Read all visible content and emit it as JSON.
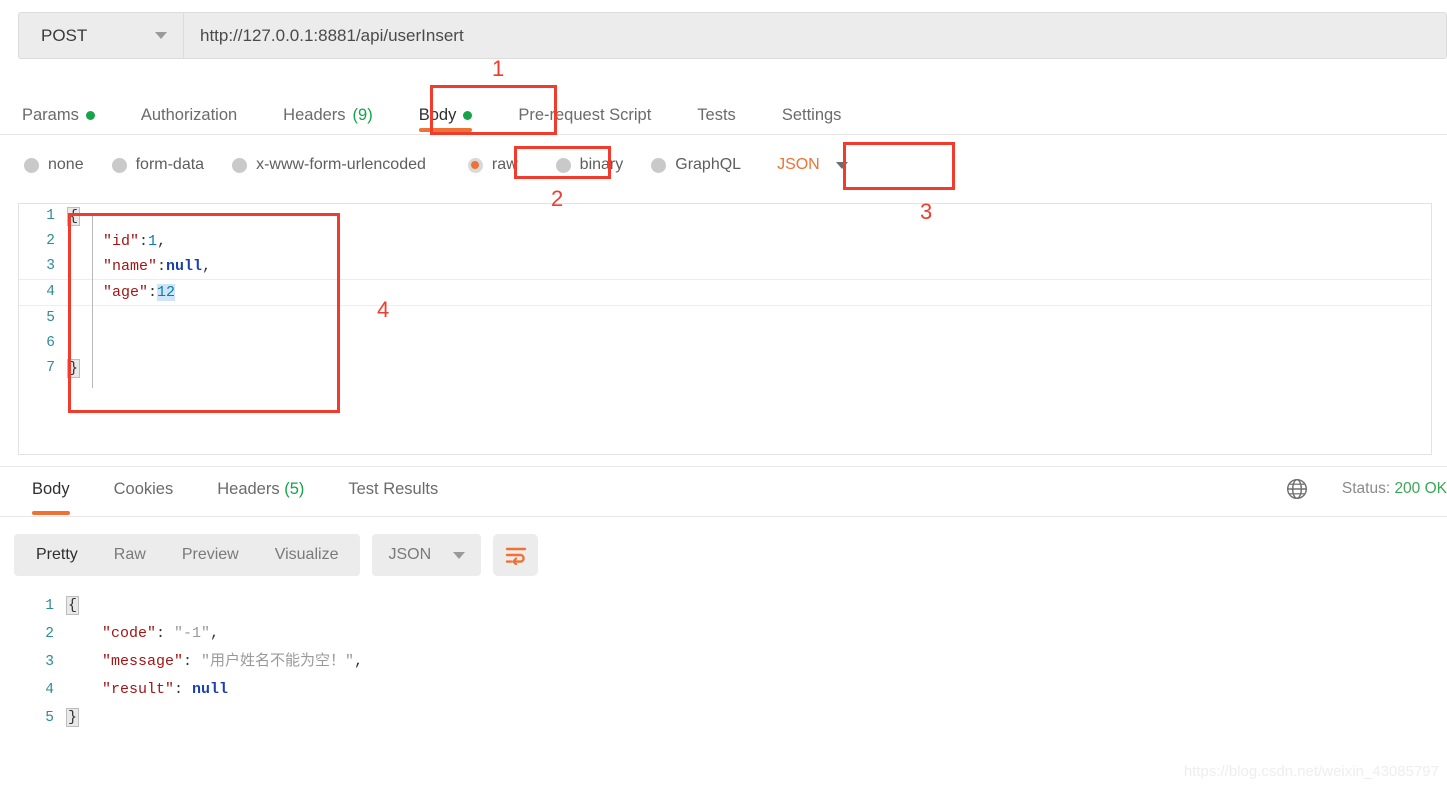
{
  "request": {
    "method": "POST",
    "url": "http://127.0.0.1:8881/api/userInsert",
    "tabs": [
      {
        "label": "Params",
        "badge": "dot"
      },
      {
        "label": "Authorization",
        "badge": ""
      },
      {
        "label": "Headers",
        "count": "(9)"
      },
      {
        "label": "Body",
        "badge": "dot",
        "active": true
      },
      {
        "label": "Pre-request Script",
        "badge": ""
      },
      {
        "label": "Tests",
        "badge": ""
      },
      {
        "label": "Settings",
        "badge": ""
      }
    ],
    "body_types": [
      {
        "label": "none",
        "selected": false
      },
      {
        "label": "form-data",
        "selected": false
      },
      {
        "label": "x-www-form-urlencoded",
        "selected": false
      },
      {
        "label": "raw",
        "selected": true
      },
      {
        "label": "binary",
        "selected": false
      },
      {
        "label": "GraphQL",
        "selected": false
      }
    ],
    "raw_format": "JSON",
    "editor_lines": [
      {
        "no": "1",
        "text": "{"
      },
      {
        "no": "2",
        "text": "    \"id\":1,"
      },
      {
        "no": "3",
        "text": "    \"name\":null,"
      },
      {
        "no": "4",
        "text": "    \"age\":12",
        "active": true
      },
      {
        "no": "5",
        "text": ""
      },
      {
        "no": "6",
        "text": ""
      },
      {
        "no": "7",
        "text": "}"
      }
    ]
  },
  "response": {
    "tabs": [
      {
        "label": "Body",
        "active": true
      },
      {
        "label": "Cookies"
      },
      {
        "label": "Headers",
        "count": "(5)"
      },
      {
        "label": "Test Results"
      }
    ],
    "status_label": "Status:",
    "status_value": "200 OK",
    "view_modes": [
      {
        "label": "Pretty",
        "active": true
      },
      {
        "label": "Raw",
        "active": false
      },
      {
        "label": "Preview",
        "active": false
      },
      {
        "label": "Visualize",
        "active": false
      }
    ],
    "format": "JSON",
    "wrap_icon": "wrap-text-icon",
    "globe_icon": "globe-icon",
    "body_lines": [
      {
        "no": "1",
        "text": "{"
      },
      {
        "no": "2",
        "key": "\"code\"",
        "sep": ": ",
        "val": "\"-1\"",
        "val_type": "str",
        "tail": ","
      },
      {
        "no": "3",
        "key": "\"message\"",
        "sep": ": ",
        "val": "\"用户姓名不能为空！\"",
        "val_type": "str",
        "tail": ","
      },
      {
        "no": "4",
        "key": "\"result\"",
        "sep": ": ",
        "val": "null",
        "val_type": "null",
        "tail": ""
      },
      {
        "no": "5",
        "text": "}"
      }
    ]
  },
  "annotations": [
    {
      "label": "1"
    },
    {
      "label": "2"
    },
    {
      "label": "3"
    },
    {
      "label": "4"
    }
  ],
  "watermark": "https://blog.csdn.net/weixin_43085797",
  "colors": {
    "accent": "#ef7234",
    "annotation": "#f03b2d",
    "success": "#16a34a",
    "status_ok": "#3aa757"
  }
}
